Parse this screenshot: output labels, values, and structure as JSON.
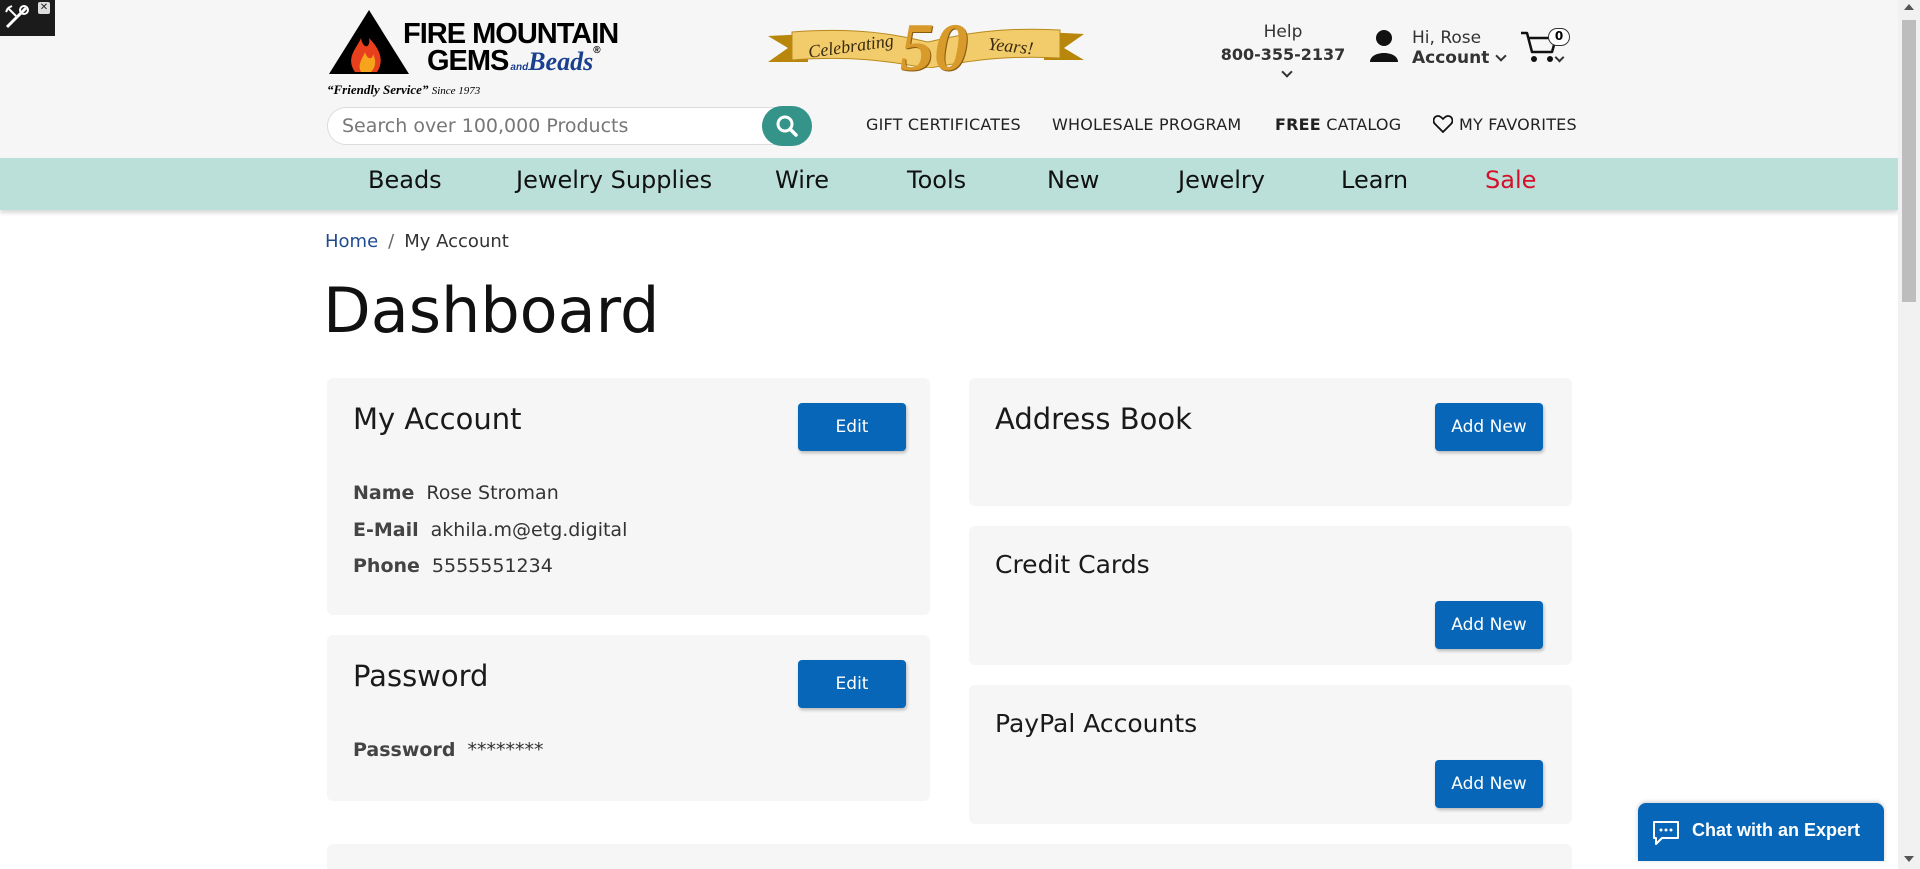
{
  "header": {
    "logo_line1": "FIRE MOUNTAIN",
    "logo_line2": "GEMS",
    "logo_and": "and",
    "logo_beads": "Beads",
    "logo_reg": "®",
    "tagline": "“Friendly Service”",
    "tagline_since": "Since 1973",
    "celebrating": "Celebrating",
    "anniversary_number": "50",
    "years": "Years!",
    "help_label": "Help",
    "help_phone": "800-355-2137",
    "greeting": "Hi, Rose",
    "account_label": "Account",
    "cart_count": "0"
  },
  "search": {
    "placeholder": "Search over 100,000 Products"
  },
  "top_links": {
    "gift": "GIFT CERTIFICATES",
    "wholesale": "WHOLESALE PROGRAM",
    "catalog_bold": "FREE",
    "catalog_rest": "CATALOG",
    "favorites": "MY FAVORITES"
  },
  "nav": {
    "items": [
      "Beads",
      "Jewelry Supplies",
      "Wire",
      "Tools",
      "New",
      "Jewelry",
      "Learn",
      "Sale"
    ]
  },
  "breadcrumb": {
    "home": "Home",
    "separator": "/",
    "current": "My Account"
  },
  "page_title": "Dashboard",
  "my_account": {
    "title": "My Account",
    "edit_label": "Edit",
    "name_key": "Name",
    "name_value": "Rose Stroman",
    "email_key": "E-Mail",
    "email_value": "akhila.m@etg.digital",
    "phone_key": "Phone",
    "phone_value": "5555551234"
  },
  "password_card": {
    "title": "Password",
    "edit_label": "Edit",
    "key": "Password",
    "value": "********"
  },
  "address_book": {
    "title": "Address Book",
    "add_label": "Add New"
  },
  "credit_cards": {
    "title": "Credit Cards",
    "add_label": "Add New"
  },
  "paypal": {
    "title": "PayPal Accounts",
    "add_label": "Add New"
  },
  "chat": {
    "label": "Chat with an Expert"
  },
  "colors": {
    "nav_bg": "#bbe0d9",
    "primary_button": "#0766b7",
    "search_button": "#34948a",
    "sale": "#d4102a",
    "card_bg": "#f6f6f6"
  },
  "icons": [
    "wrench-icon",
    "close-icon",
    "flame-mountain-logo-icon",
    "chevron-down-icon",
    "user-icon",
    "cart-icon",
    "search-icon",
    "heart-icon",
    "chat-icon"
  ]
}
